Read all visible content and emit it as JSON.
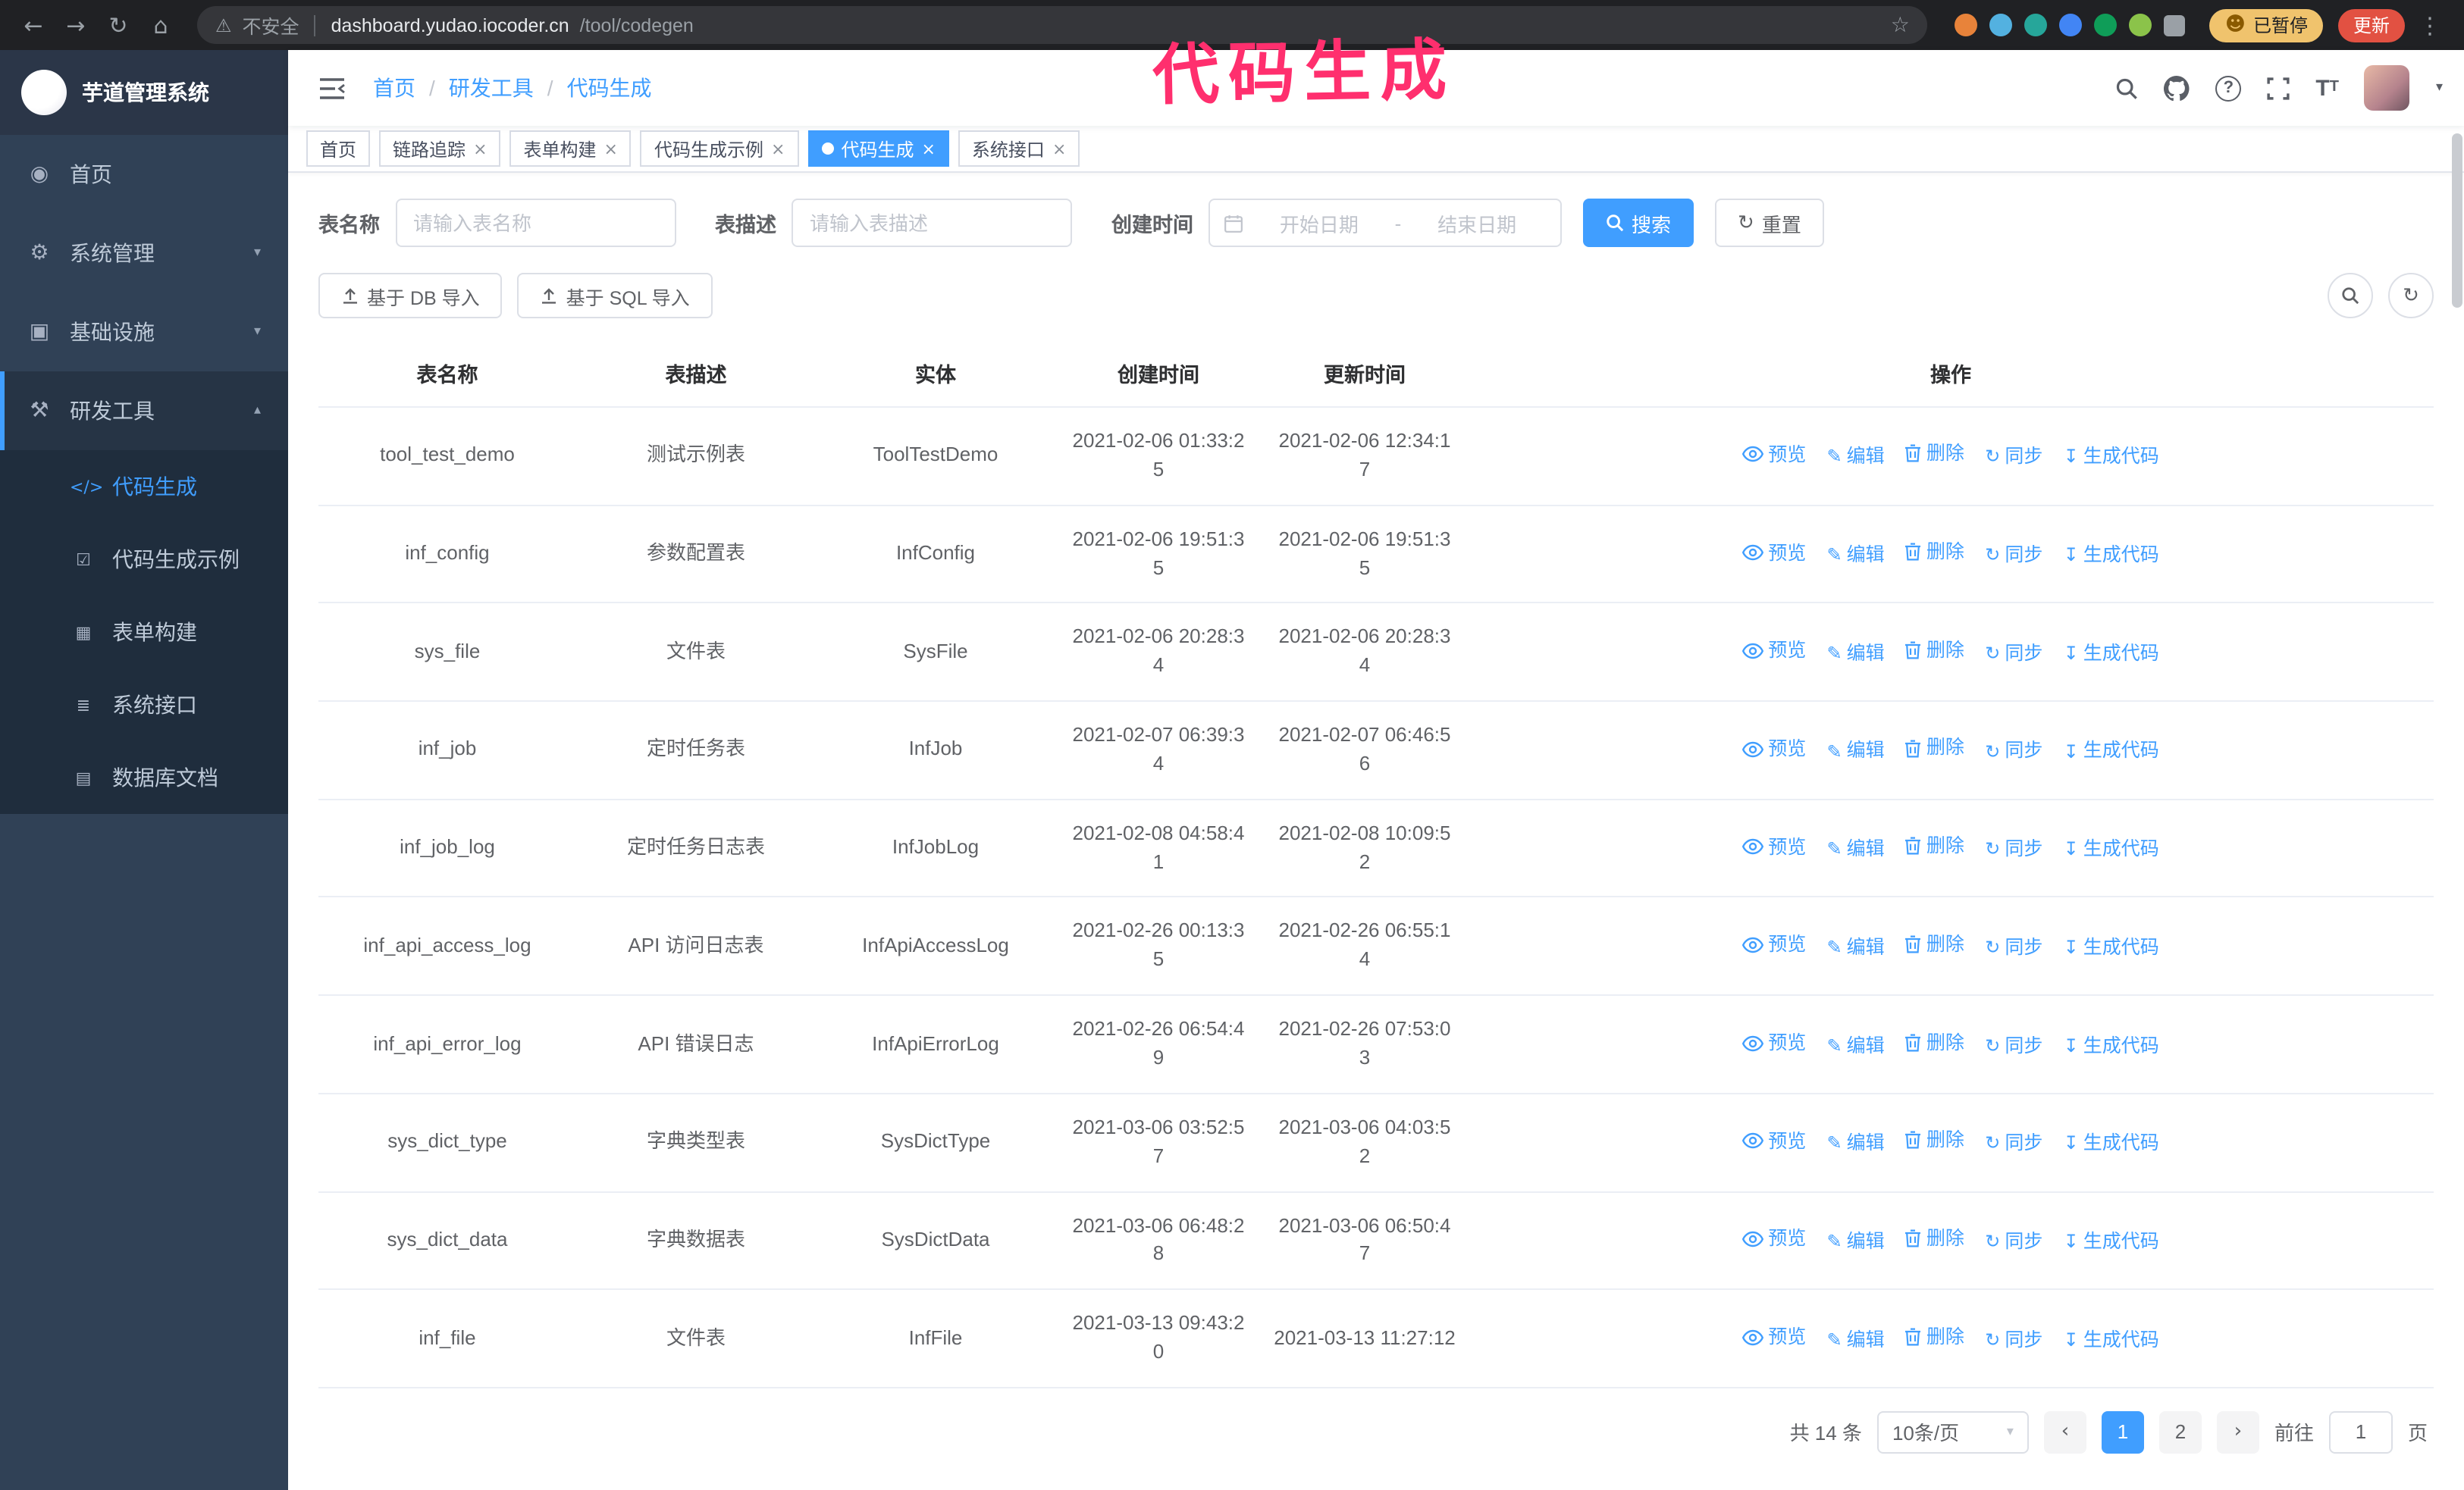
{
  "annotation": "代码生成",
  "browser": {
    "security_label": "不安全",
    "url_domain": "dashboard.yudao.iocoder.cn",
    "url_path": "/tool/codegen",
    "paused_badge": "已暂停",
    "update_button": "更新"
  },
  "icons": {
    "back": "←",
    "forward": "→",
    "reload": "↻",
    "home": "⌂",
    "warning": "⚠",
    "star": "☆",
    "face": "☻",
    "kebab": "⋮",
    "menu_home": "◉",
    "menu_system": "⚙",
    "menu_infra": "▣",
    "menu_tools": "⚒",
    "sub_codegen": "</>",
    "sub_demo": "☑",
    "sub_form": "▦",
    "sub_api": "≣",
    "sub_db": "▤",
    "chevron_down": "▾",
    "chevron_up": "▴",
    "close": "×",
    "reset": "↻",
    "refresh": "↻",
    "pencil": "✎",
    "sync": "↻",
    "download": "↧",
    "prev": "‹",
    "next": "›",
    "caret": "▾"
  },
  "sidebar": {
    "logo_title": "芋道管理系统",
    "menu": [
      {
        "label": "首页"
      },
      {
        "label": "系统管理"
      },
      {
        "label": "基础设施"
      },
      {
        "label": "研发工具"
      }
    ],
    "submenu": [
      {
        "label": "代码生成"
      },
      {
        "label": "代码生成示例"
      },
      {
        "label": "表单构建"
      },
      {
        "label": "系统接口"
      },
      {
        "label": "数据库文档"
      }
    ]
  },
  "header": {
    "breadcrumb": [
      {
        "label": "首页"
      },
      {
        "label": "研发工具"
      },
      {
        "label": "代码生成"
      }
    ]
  },
  "tabs": [
    {
      "label": "首页"
    },
    {
      "label": "链路追踪"
    },
    {
      "label": "表单构建"
    },
    {
      "label": "代码生成示例"
    },
    {
      "label": "代码生成"
    },
    {
      "label": "系统接口"
    }
  ],
  "filters": {
    "table_name_label": "表名称",
    "table_name_placeholder": "请输入表名称",
    "table_desc_label": "表描述",
    "table_desc_placeholder": "请输入表描述",
    "create_time_label": "创建时间",
    "date_start_placeholder": "开始日期",
    "date_separator": "-",
    "date_end_placeholder": "结束日期",
    "search_button": "搜索",
    "reset_button": "重置"
  },
  "toolbar": {
    "import_db_button": "基于 DB 导入",
    "import_sql_button": "基于 SQL 导入"
  },
  "table": {
    "columns": [
      "表名称",
      "表描述",
      "实体",
      "创建时间",
      "更新时间",
      "操作"
    ],
    "actions": [
      "预览",
      "编辑",
      "删除",
      "同步",
      "生成代码"
    ],
    "rows": [
      {
        "name": "tool_test_demo",
        "desc": "测试示例表",
        "entity": "ToolTestDemo",
        "created": "2021-02-06 01:33:25",
        "updated": "2021-02-06 12:34:17"
      },
      {
        "name": "inf_config",
        "desc": "参数配置表",
        "entity": "InfConfig",
        "created": "2021-02-06 19:51:35",
        "updated": "2021-02-06 19:51:35"
      },
      {
        "name": "sys_file",
        "desc": "文件表",
        "entity": "SysFile",
        "created": "2021-02-06 20:28:34",
        "updated": "2021-02-06 20:28:34"
      },
      {
        "name": "inf_job",
        "desc": "定时任务表",
        "entity": "InfJob",
        "created": "2021-02-07 06:39:34",
        "updated": "2021-02-07 06:46:56"
      },
      {
        "name": "inf_job_log",
        "desc": "定时任务日志表",
        "entity": "InfJobLog",
        "created": "2021-02-08 04:58:41",
        "updated": "2021-02-08 10:09:52"
      },
      {
        "name": "inf_api_access_log",
        "desc": "API 访问日志表",
        "entity": "InfApiAccessLog",
        "created": "2021-02-26 00:13:35",
        "updated": "2021-02-26 06:55:14"
      },
      {
        "name": "inf_api_error_log",
        "desc": "API 错误日志",
        "entity": "InfApiErrorLog",
        "created": "2021-02-26 06:54:49",
        "updated": "2021-02-26 07:53:03"
      },
      {
        "name": "sys_dict_type",
        "desc": "字典类型表",
        "entity": "SysDictType",
        "created": "2021-03-06 03:52:57",
        "updated": "2021-03-06 04:03:52"
      },
      {
        "name": "sys_dict_data",
        "desc": "字典数据表",
        "entity": "SysDictData",
        "created": "2021-03-06 06:48:28",
        "updated": "2021-03-06 06:50:47"
      },
      {
        "name": "inf_file",
        "desc": "文件表",
        "entity": "InfFile",
        "created": "2021-03-13 09:43:20",
        "updated": "2021-03-13 11:27:12"
      }
    ]
  },
  "pagination": {
    "total_label": "共 14 条",
    "page_size": "10条/页",
    "pages": [
      "1",
      "2"
    ],
    "goto_label": "前往",
    "goto_value": "1",
    "goto_suffix": "页"
  },
  "colors": {
    "primary": "#409eff",
    "annotation": "#ff2f6e",
    "sidebar_bg": "#304156",
    "submenu_bg": "#1f2d3d"
  }
}
